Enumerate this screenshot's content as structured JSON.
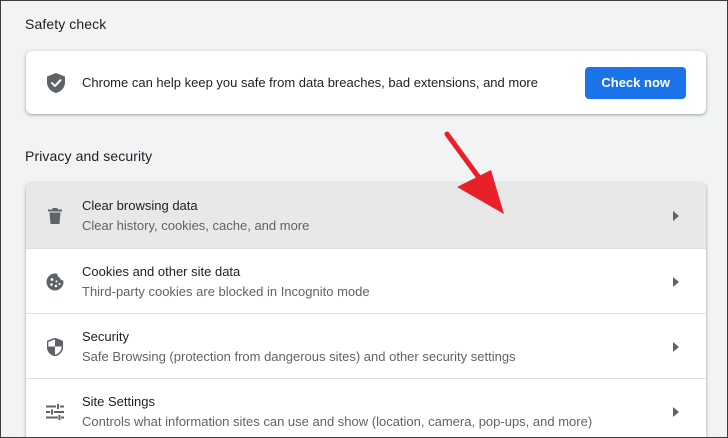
{
  "safety_check": {
    "title": "Safety check",
    "description": "Chrome can help keep you safe from data breaches, bad extensions, and more",
    "button_label": "Check now",
    "icon": "shield-check-icon"
  },
  "privacy": {
    "title": "Privacy and security",
    "items": [
      {
        "title": "Clear browsing data",
        "subtitle": "Clear history, cookies, cache, and more",
        "icon": "trash-icon"
      },
      {
        "title": "Cookies and other site data",
        "subtitle": "Third-party cookies are blocked in Incognito mode",
        "icon": "cookie-icon"
      },
      {
        "title": "Security",
        "subtitle": "Safe Browsing (protection from dangerous sites) and other security settings",
        "icon": "shield-icon"
      },
      {
        "title": "Site Settings",
        "subtitle": "Controls what information sites can use and show (location, camera, pop-ups, and more)",
        "icon": "tune-icon"
      }
    ]
  },
  "colors": {
    "accent": "#1a73e8",
    "annotation_arrow": "#e8202a",
    "hover_row": "#e8e8e8"
  }
}
